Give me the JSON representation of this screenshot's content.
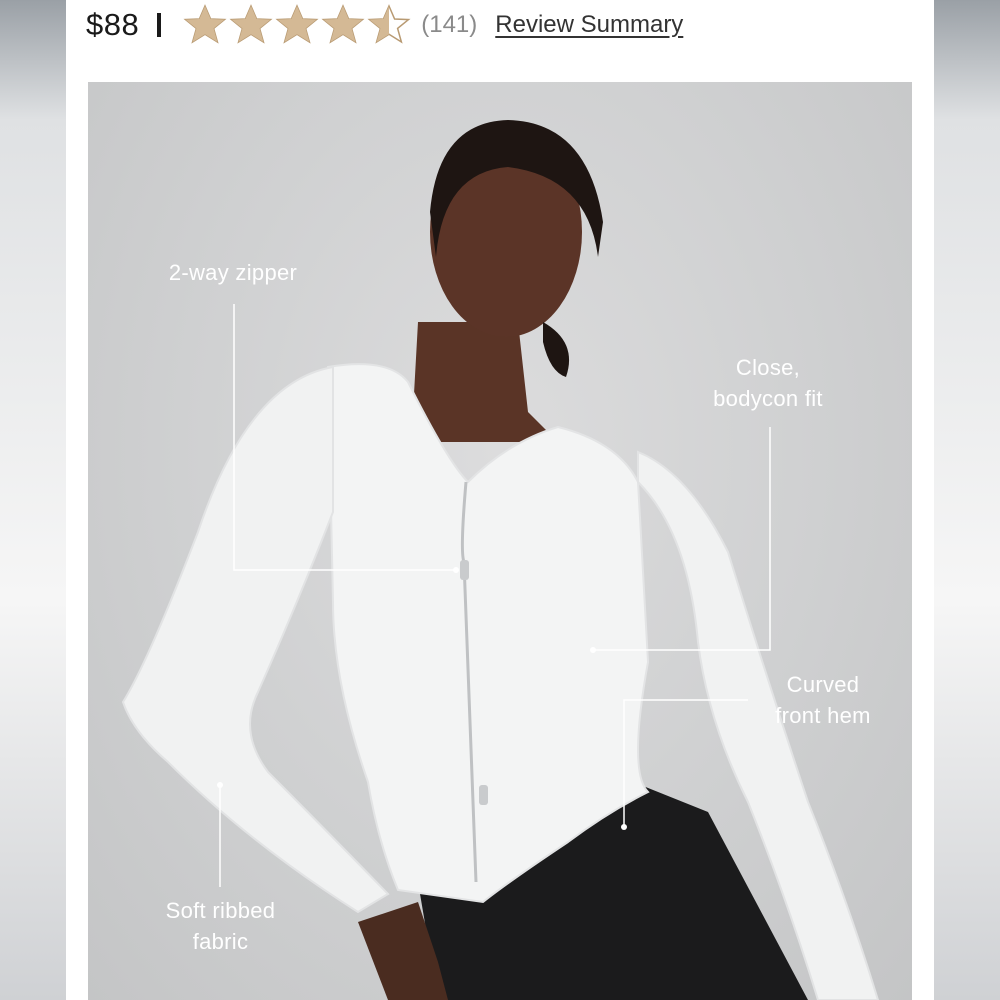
{
  "header": {
    "price": "$88",
    "rating": 4.5,
    "rating_max": 5,
    "review_count": "(141)",
    "review_link": "Review Summary"
  },
  "product_image": {
    "annotations": {
      "zipper": "2-way zipper",
      "fit_line1": "Close,",
      "fit_line2": "bodycon fit",
      "hem_line1": "Curved",
      "hem_line2": "front hem",
      "fabric_line1": "Soft ribbed",
      "fabric_line2": "fabric"
    }
  },
  "colors": {
    "star_fill": "#d4b995",
    "star_outline": "#b89a72",
    "annotation_text": "#ffffff"
  }
}
